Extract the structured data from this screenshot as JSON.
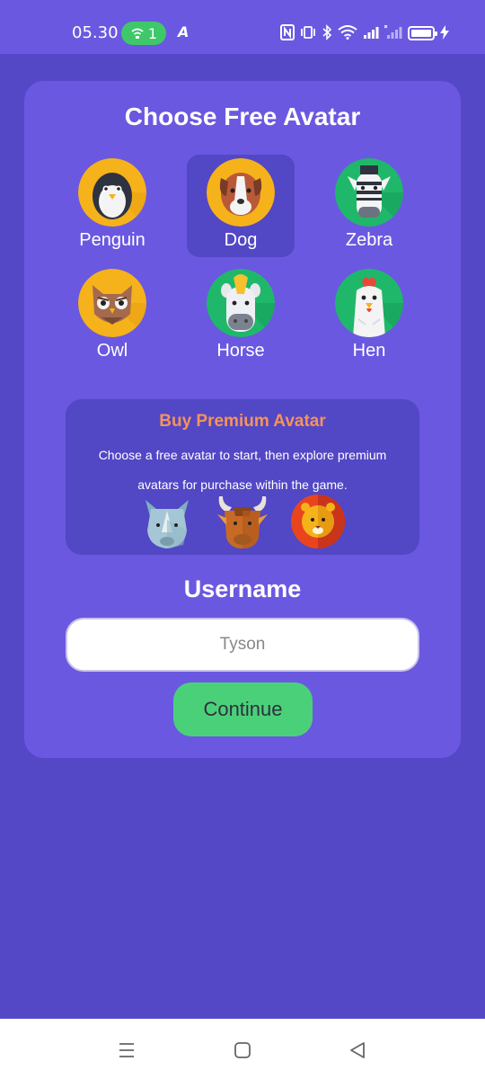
{
  "status_bar": {
    "time": "05.30",
    "hotspot_count": "1",
    "app_indicator": "A",
    "icons": [
      "nfc-icon",
      "vibrate-icon",
      "bluetooth-icon",
      "wifi-icon",
      "signal-icon",
      "signal-2-icon",
      "battery-icon",
      "charging-icon"
    ]
  },
  "title": "Choose Free Avatar",
  "avatars": [
    {
      "label": "Penguin",
      "icon": "penguin-icon",
      "selected": false
    },
    {
      "label": "Dog",
      "icon": "dog-icon",
      "selected": true
    },
    {
      "label": "Zebra",
      "icon": "zebra-icon",
      "selected": false
    },
    {
      "label": "Owl",
      "icon": "owl-icon",
      "selected": false
    },
    {
      "label": "Horse",
      "icon": "horse-icon",
      "selected": false
    },
    {
      "label": "Hen",
      "icon": "hen-icon",
      "selected": false
    }
  ],
  "premium": {
    "title": "Buy Premium Avatar",
    "description": "Choose a free avatar to start, then explore premium avatars for purchase within the game.",
    "animals": [
      "rhino-icon",
      "bull-icon",
      "lion-icon"
    ]
  },
  "username": {
    "label": "Username",
    "placeholder": "Tyson"
  },
  "continue_label": "Continue",
  "nav": {
    "icons": [
      "menu-icon",
      "home-icon",
      "back-icon"
    ]
  },
  "colors": {
    "background": "#5548c7",
    "card": "#6b58e0",
    "selected": "#5247c4",
    "accent_orange": "#f5935a",
    "continue_green": "#4bd07a"
  }
}
